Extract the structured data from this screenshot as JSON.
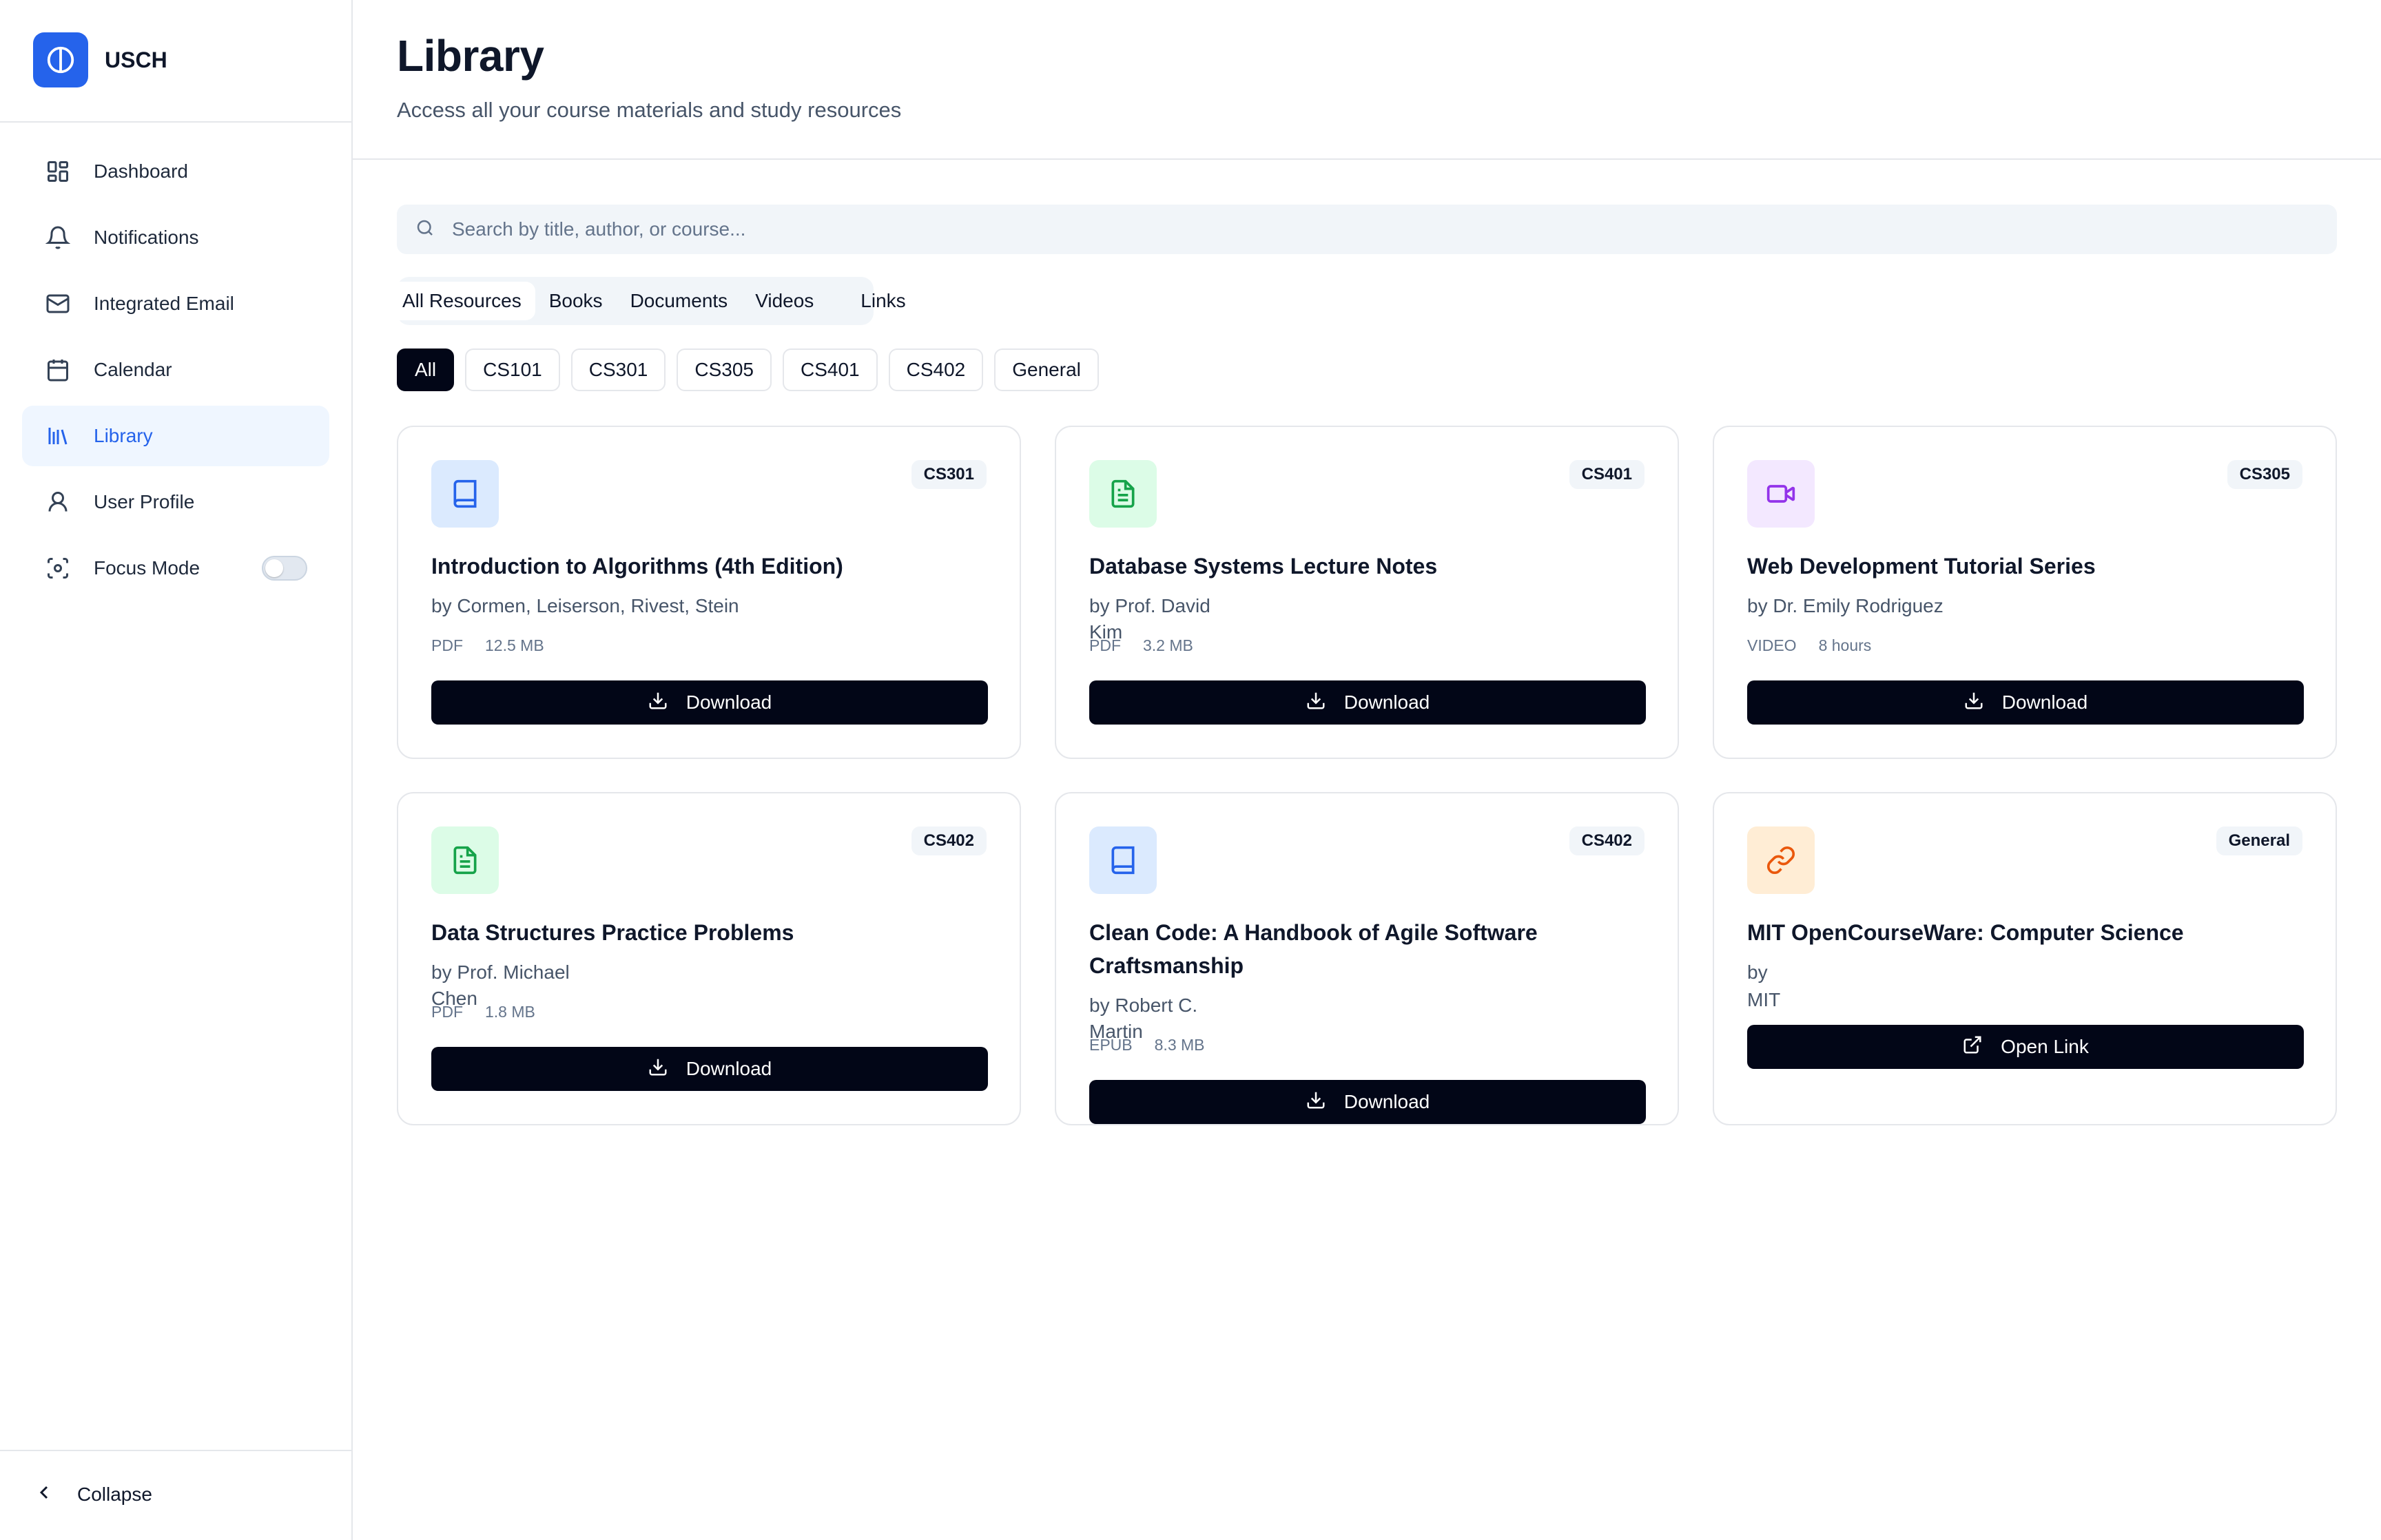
{
  "brand": {
    "name": "USCH"
  },
  "sidebar": {
    "items": [
      {
        "label": "Dashboard",
        "icon": "dashboard-icon"
      },
      {
        "label": "Notifications",
        "icon": "bell-icon"
      },
      {
        "label": "Integrated Email",
        "icon": "mail-icon"
      },
      {
        "label": "Calendar",
        "icon": "calendar-icon"
      },
      {
        "label": "Library",
        "icon": "library-icon",
        "active": true
      },
      {
        "label": "User Profile",
        "icon": "user-icon"
      },
      {
        "label": "Focus Mode",
        "icon": "focus-icon",
        "toggle": false
      }
    ],
    "collapse_label": "Collapse"
  },
  "header": {
    "title": "Library",
    "subtitle": "Access all your course materials and study resources"
  },
  "search": {
    "placeholder": "Search by title, author, or course..."
  },
  "type_tabs": [
    "All Resources",
    "Books",
    "Documents",
    "Videos",
    "Links"
  ],
  "active_type_tab": "All Resources",
  "course_filters": [
    "All",
    "CS101",
    "CS301",
    "CS305",
    "CS401",
    "CS402",
    "General"
  ],
  "active_course_filter": "All",
  "colors": {
    "accent": "#2563eb",
    "book_bg": "#dbeafe",
    "book_fg": "#2563eb",
    "doc_bg": "#dcfce7",
    "doc_fg": "#16a34a",
    "video_bg": "#f3e8ff",
    "video_fg": "#9333ea",
    "link_bg": "#ffedd5",
    "link_fg": "#ea580c",
    "button": "#020617"
  },
  "resources": [
    {
      "title": "Introduction to Algorithms (4th Edition)",
      "author_lines": [
        "by Cormen, Leiserson, Rivest, Stein"
      ],
      "format": "PDF",
      "size": "12.5 MB",
      "course": "CS301",
      "kind": "book",
      "action": "Download"
    },
    {
      "title": "Database Systems Lecture Notes",
      "author_lines": [
        "by Prof. David",
        "Kim"
      ],
      "format": "PDF",
      "size": "3.2 MB",
      "course": "CS401",
      "kind": "document",
      "action": "Download"
    },
    {
      "title": "Web Development Tutorial Series",
      "author_lines": [
        "by Dr. Emily Rodriguez"
      ],
      "format": "VIDEO",
      "size": "8 hours",
      "course": "CS305",
      "kind": "video",
      "action": "Download"
    },
    {
      "title": "Data Structures Practice Problems",
      "author_lines": [
        "by Prof. Michael",
        "Chen"
      ],
      "format": "PDF",
      "size": "1.8 MB",
      "course": "CS402",
      "kind": "document",
      "action": "Download"
    },
    {
      "title": "Clean Code: A Handbook of Agile Software Craftsmanship",
      "author_lines": [
        "by Robert C.",
        "Martin"
      ],
      "format": "EPUB",
      "size": "8.3 MB",
      "course": "CS402",
      "kind": "book",
      "action": "Download"
    },
    {
      "title": "MIT OpenCourseWare: Computer Science",
      "author_lines": [
        "by",
        "MIT"
      ],
      "format": "",
      "size": "",
      "course": "General",
      "kind": "link",
      "action": "Open Link"
    }
  ]
}
